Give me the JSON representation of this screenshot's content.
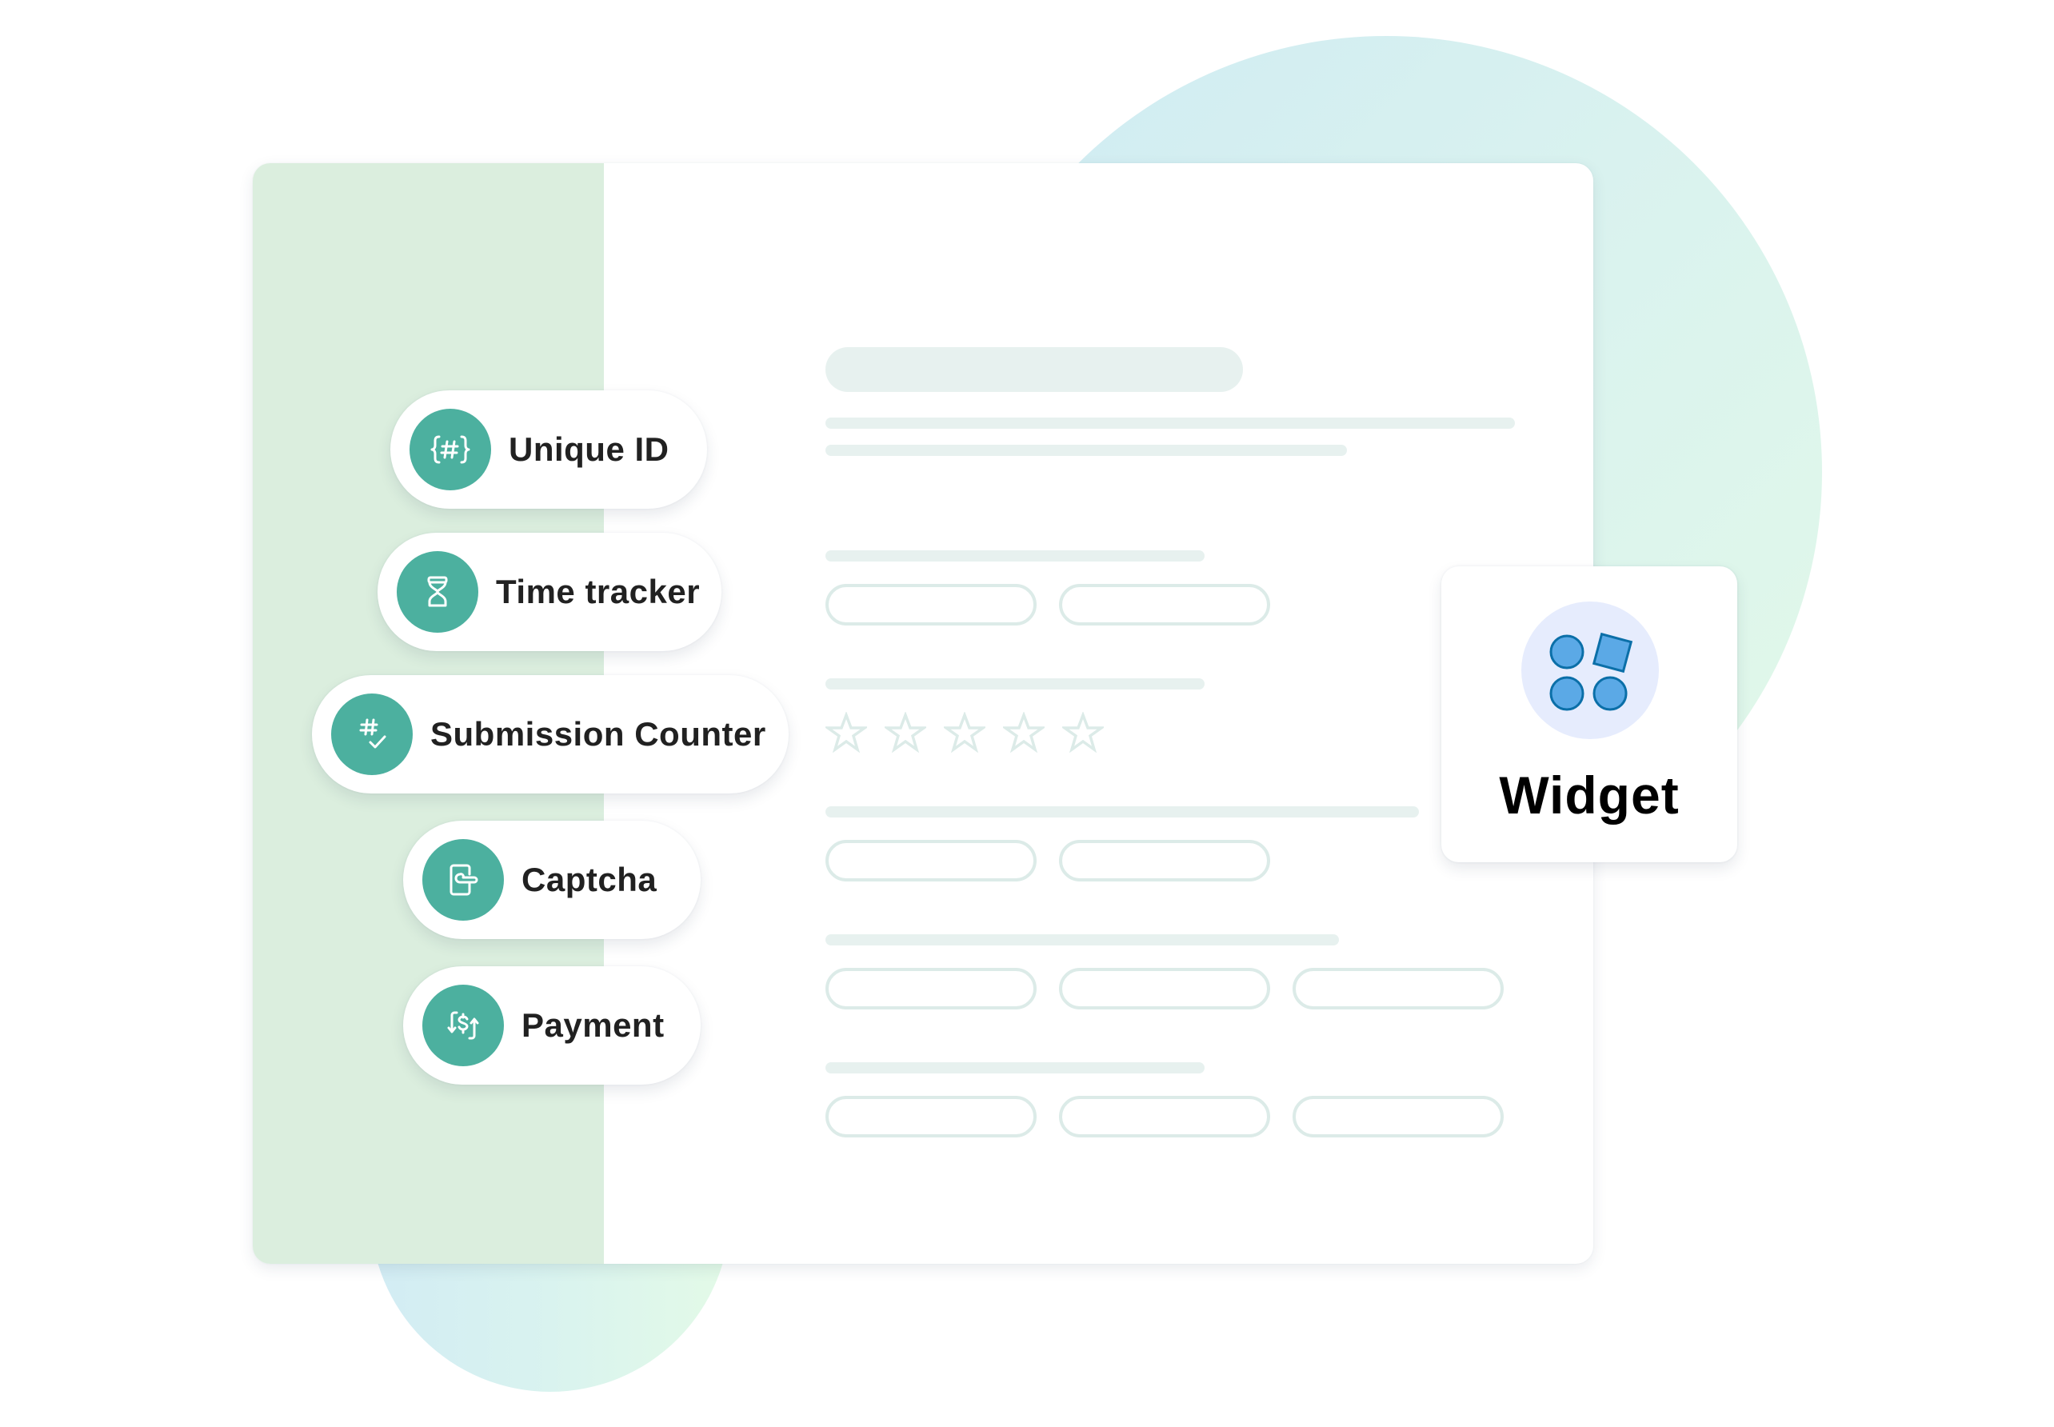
{
  "colors": {
    "accent": "#4cb09f",
    "sidebar": "#dbeede",
    "skeleton": "#e7f1ef",
    "skeleton_border": "#dcebe8",
    "widget_icon_bg": "#e6ecfd",
    "widget_shape_fill": "#5ba9e6",
    "widget_shape_stroke": "#0b6fa8",
    "label_text": "#212121"
  },
  "fields": [
    {
      "label": "Unique ID",
      "icon": "hash-braces-icon"
    },
    {
      "label": "Time tracker",
      "icon": "hourglass-icon"
    },
    {
      "label": "Submission Counter",
      "icon": "hash-check-icon"
    },
    {
      "label": "Captcha",
      "icon": "door-handle-icon"
    },
    {
      "label": "Payment",
      "icon": "dollar-exchange-icon"
    }
  ],
  "widget": {
    "label": "Widget",
    "icon": "shapes-icon"
  },
  "form_preview": {
    "rating_stars": 5,
    "rating_value": 0,
    "option_rows": [
      2,
      2,
      3,
      3
    ]
  }
}
